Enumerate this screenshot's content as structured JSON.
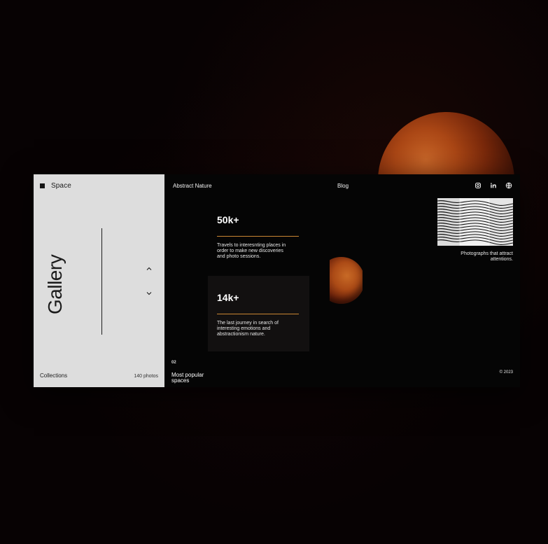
{
  "sidebar": {
    "brand": "Space",
    "title": "Gallery",
    "collections_label": "Collections",
    "photo_count": "140 photos"
  },
  "nav": {
    "abstract": "Abstract Nature",
    "blog": "Blog"
  },
  "social": {
    "items": [
      {
        "icon": "instagram-icon"
      },
      {
        "icon": "linkedin-icon"
      },
      {
        "icon": "globe-icon"
      }
    ]
  },
  "stats": [
    {
      "value": "50k+",
      "description": "Travels to interesnting places in order to make new discoveries and photo sessions."
    },
    {
      "value": "14k+",
      "description": "The last journey in search of interesting emotions and abstractionism nature."
    }
  ],
  "featured": {
    "caption": "Photographs that attract attentions."
  },
  "footer": {
    "index": "02",
    "label": "Most popular spaces",
    "copyright": "© 2023"
  },
  "theme": {
    "background": "#070203",
    "sidebar": "#dddddd",
    "panel": "#050505",
    "accent": "#c98632",
    "planet": "#b24a16"
  }
}
